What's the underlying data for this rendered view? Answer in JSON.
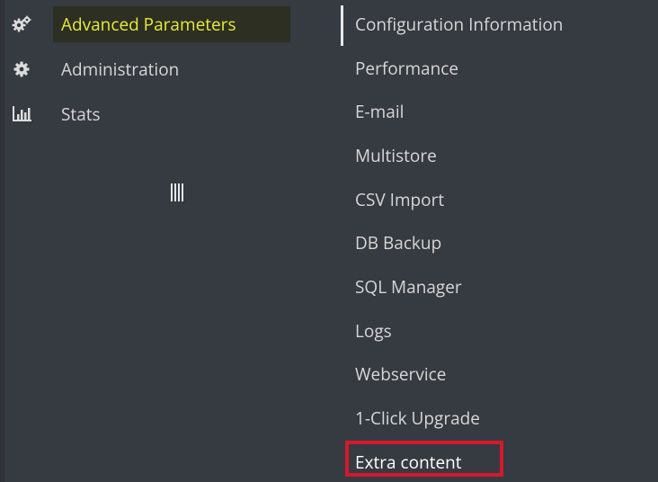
{
  "sidebar": {
    "items": [
      {
        "label": "Advanced Parameters",
        "icon": "gears-icon",
        "active": true,
        "active_color": "#e7ea39"
      },
      {
        "label": "Administration",
        "icon": "gear-icon",
        "active": false
      },
      {
        "label": "Stats",
        "icon": "bar-chart-icon",
        "active": false
      }
    ],
    "collapse_icon": "vertical-bars-icon"
  },
  "submenu": {
    "items": [
      {
        "label": "Configuration Information"
      },
      {
        "label": "Performance"
      },
      {
        "label": "E-mail"
      },
      {
        "label": "Multistore"
      },
      {
        "label": "CSV Import"
      },
      {
        "label": "DB Backup"
      },
      {
        "label": "SQL Manager"
      },
      {
        "label": "Logs"
      },
      {
        "label": "Webservice"
      },
      {
        "label": "1-Click Upgrade"
      },
      {
        "label": "Extra content",
        "highlighted": true,
        "highlight_color": "#d6182c"
      }
    ]
  },
  "colors": {
    "background": "#363a41",
    "text": "#d7d7d7",
    "active_text": "#e7ea39"
  }
}
